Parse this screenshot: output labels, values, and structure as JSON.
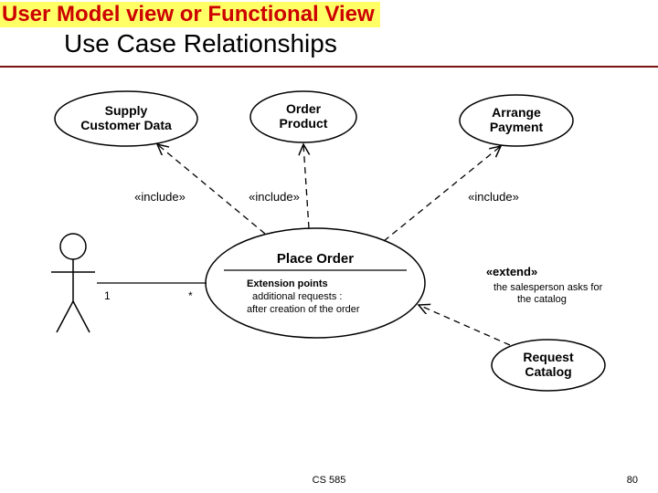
{
  "header": {
    "strip": "User Model view or Functional View",
    "title": "Use Case Relationships"
  },
  "uc": {
    "supply": {
      "l1": "Supply",
      "l2": "Customer Data"
    },
    "order": {
      "l1": "Order",
      "l2": "Product"
    },
    "arrange": {
      "l1": "Arrange",
      "l2": "Payment"
    },
    "place": {
      "title": "Place Order",
      "ep_head": "Extension points",
      "ep1": "additional requests :",
      "ep2": "after creation of the order"
    },
    "request": {
      "l1": "Request",
      "l2": "Catalog"
    }
  },
  "labels": {
    "include": "«include»",
    "extend": "«extend»",
    "ext_note1": "the salesperson asks for",
    "ext_note2": "the catalog"
  },
  "assoc": {
    "m1": "1",
    "m2": "*"
  },
  "footer": {
    "center": "CS 585",
    "page": "80"
  }
}
